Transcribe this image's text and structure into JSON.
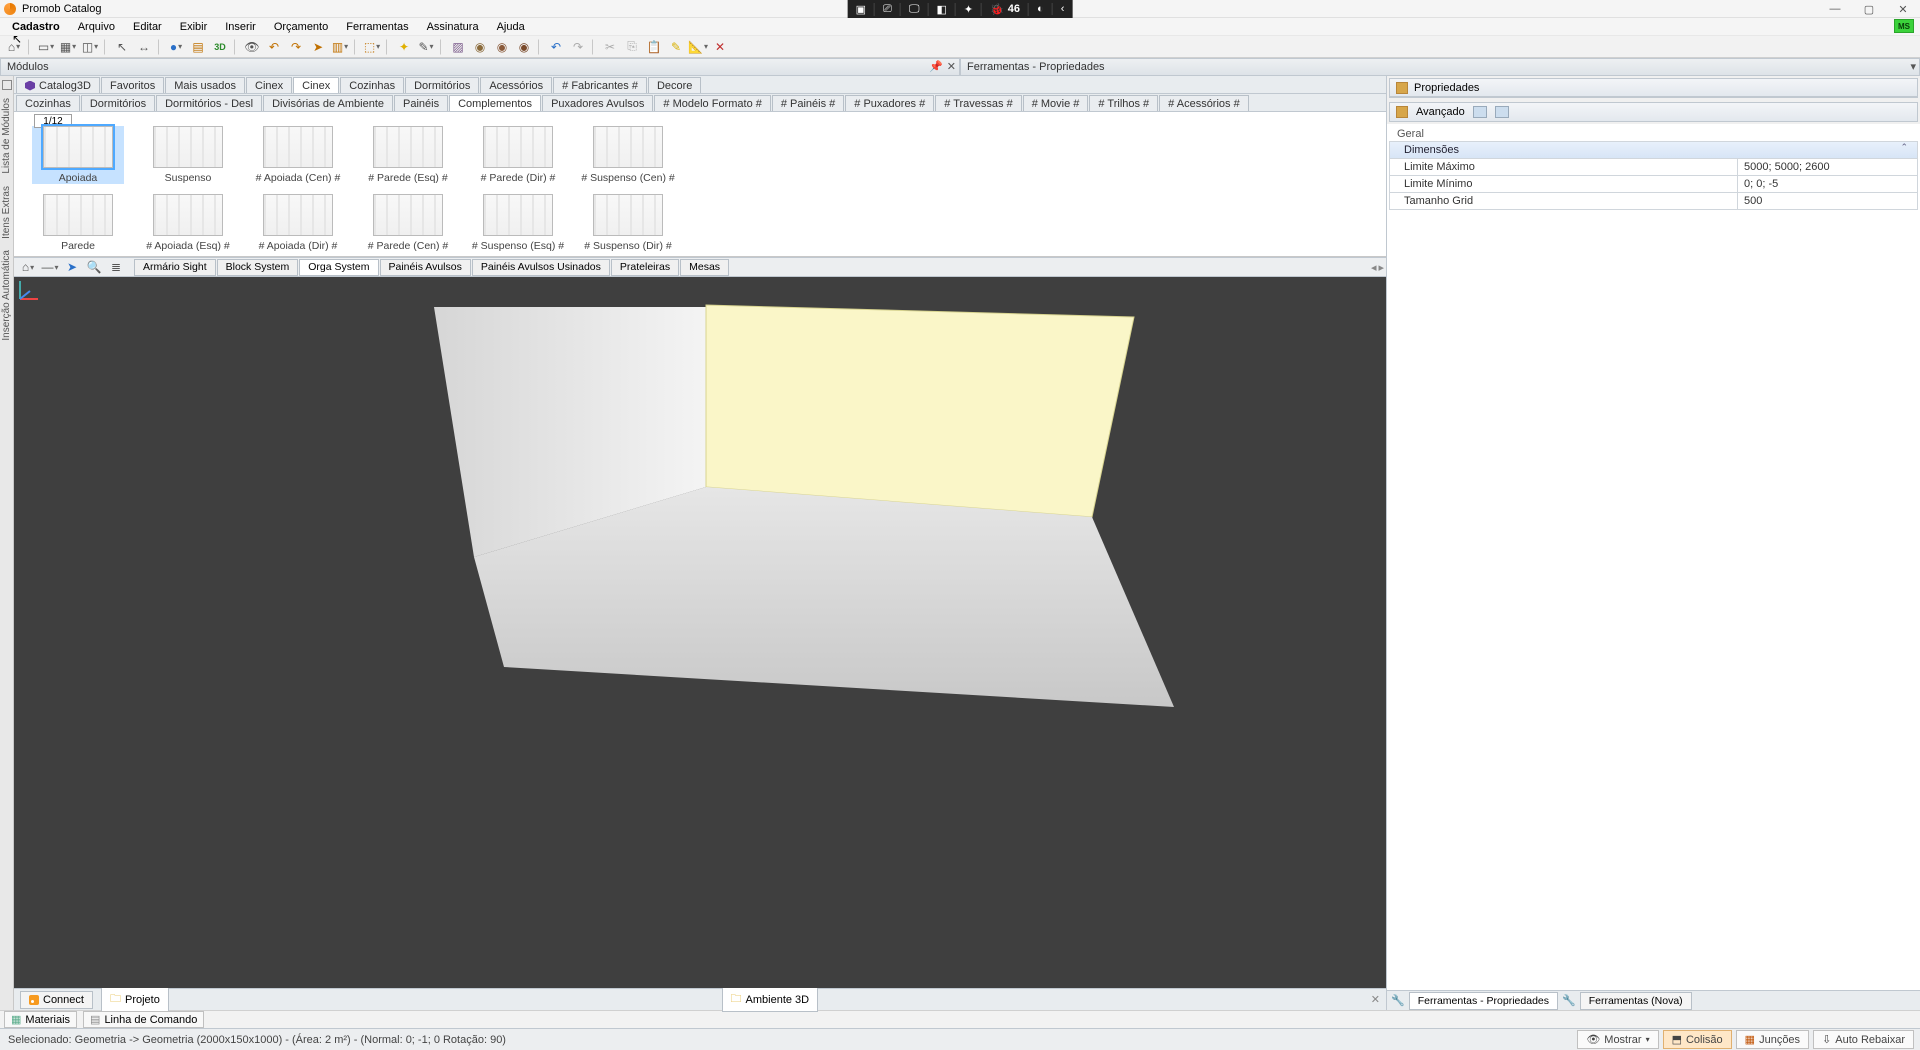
{
  "titlebar": {
    "title": "Promob Catalog"
  },
  "center_widgets": {
    "badge": "46"
  },
  "menubar": [
    "Cadastro",
    "Arquivo",
    "Editar",
    "Exibir",
    "Inserir",
    "Orçamento",
    "Ferramentas",
    "Assinatura",
    "Ajuda"
  ],
  "menubar_green": "MS",
  "panels": {
    "modules": "Módulos",
    "tools": "Ferramentas - Propriedades"
  },
  "module_tabs_row1": [
    "Catalog3D",
    "Favoritos",
    "Mais usados",
    "Cinex",
    "Cinex",
    "Cozinhas",
    "Dormitórios",
    "Acessórios",
    "# Fabricantes #",
    "Decore"
  ],
  "module_tabs_row1_active": 4,
  "module_tabs_row2": [
    "Cozinhas",
    "Dormitórios",
    "Dormitórios - Desl",
    "Divisórias de Ambiente",
    "Painéis",
    "Complementos",
    "Puxadores Avulsos",
    "# Modelo Formato #",
    "# Painéis #",
    "# Puxadores #",
    "# Travessas #",
    "# Movie #",
    "# Trilhos #",
    "# Acessórios #"
  ],
  "module_tabs_row2_active": 5,
  "module_count": "1/12",
  "modules_r1": [
    {
      "name": "Apoiada",
      "sel": true
    },
    {
      "name": "Suspenso"
    },
    {
      "name": "# Apoiada (Cen) #"
    },
    {
      "name": "# Parede (Esq) #"
    },
    {
      "name": "# Parede (Dir) #"
    },
    {
      "name": "# Suspenso (Cen) #"
    }
  ],
  "modules_r2": [
    {
      "name": "Parede"
    },
    {
      "name": "# Apoiada (Esq) #"
    },
    {
      "name": "# Apoiada (Dir) #"
    },
    {
      "name": "# Parede (Cen) #"
    },
    {
      "name": "# Suspenso (Esq) #"
    },
    {
      "name": "# Suspenso (Dir) #"
    }
  ],
  "inner_tabs": [
    "Armário Sight",
    "Block System",
    "Orga System",
    "Painéis Avulsos",
    "Painéis Avulsos Usinados",
    "Prateleiras",
    "Mesas"
  ],
  "inner_tabs_active": 2,
  "bottom_left_tabs": {
    "connect": "Connect",
    "project": "Projeto"
  },
  "bottom_center_tab": "Ambiente 3D",
  "status_tabs": {
    "materials": "Materiais",
    "cmdline": "Linha de Comando"
  },
  "statusbar_text": "Selecionado: Geometria -> Geometria (2000x150x1000) - (Área: 2 m²) - (Normal: 0; -1; 0 Rotação: 90)",
  "status_right": {
    "mostrar": "Mostrar",
    "colisao": "Colisão",
    "juncoes": "Junções",
    "autorebaixar": "Auto Rebaixar"
  },
  "props": {
    "header": "Propriedades",
    "advanced": "Avançado",
    "group": "Geral",
    "dim_header": "Dimensões",
    "rows": [
      {
        "k": "Limite Máximo",
        "v": "5000; 5000; 2600"
      },
      {
        "k": "Limite Mínimo",
        "v": "0; 0; -5"
      },
      {
        "k": "Tamanho Grid",
        "v": "500"
      }
    ]
  },
  "right_tabs": {
    "a": "Ferramentas - Propriedades",
    "b": "Ferramentas (Nova)"
  },
  "sidetabs": [
    "Lista de Módulos",
    "Itens Extras",
    "Inserção Automática"
  ]
}
